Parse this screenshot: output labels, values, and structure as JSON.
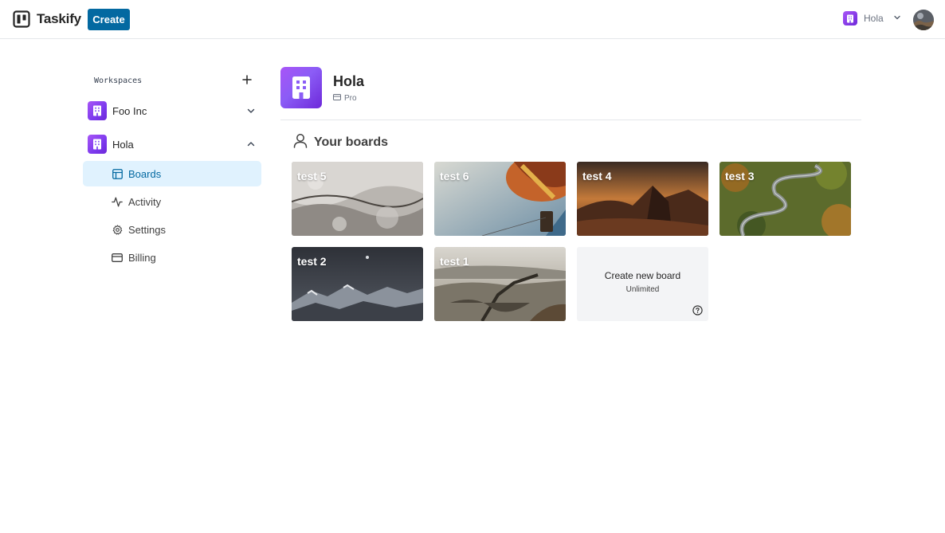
{
  "navbar": {
    "logo_text": "Taskify",
    "create_label": "Create",
    "org_switcher_name": "Hola"
  },
  "sidebar": {
    "workspaces_title": "Workspaces",
    "workspaces": [
      {
        "name": "Foo Inc",
        "expanded": false
      },
      {
        "name": "Hola",
        "expanded": true
      }
    ],
    "nav_items": [
      {
        "label": "Boards",
        "icon": "layout-icon",
        "active": true
      },
      {
        "label": "Activity",
        "icon": "activity-icon",
        "active": false
      },
      {
        "label": "Settings",
        "icon": "settings-icon",
        "active": false
      },
      {
        "label": "Billing",
        "icon": "credit-card-icon",
        "active": false
      }
    ]
  },
  "main": {
    "org_name": "Hola",
    "org_plan": "Pro",
    "boards_heading": "Your boards",
    "boards": [
      {
        "title": "test 5"
      },
      {
        "title": "test 6"
      },
      {
        "title": "test 4"
      },
      {
        "title": "test 3"
      },
      {
        "title": "test 2"
      },
      {
        "title": "test 1"
      }
    ],
    "create_board": {
      "label": "Create new board",
      "sublabel": "Unlimited"
    }
  },
  "colors": {
    "brand": "#0369a1",
    "active_nav_bg": "#e0f2fe",
    "workspace_avatar": "#7c3aed"
  }
}
